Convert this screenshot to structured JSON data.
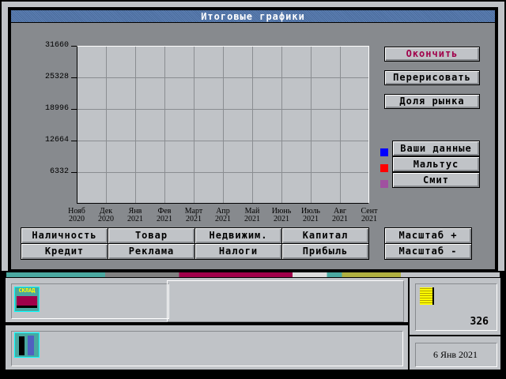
{
  "window": {
    "title": "Итоговые графики"
  },
  "chart_data": {
    "type": "line",
    "title": "Итоговые графики",
    "x": [
      "Нояб 2020",
      "Дек 2020",
      "Янв 2021",
      "Фев 2021",
      "Март 2021",
      "Апр 2021",
      "Май 2021",
      "Июнь 2021",
      "Июль 2021",
      "Авг 2021",
      "Сент 2021"
    ],
    "x_top": [
      "Нояб",
      "Дек",
      "Янв",
      "Фев",
      "Март",
      "Апр",
      "Май",
      "Июнь",
      "Июль",
      "Авг",
      "Сент"
    ],
    "x_bottom": [
      "2020",
      "2020",
      "2021",
      "2021",
      "2021",
      "2021",
      "2021",
      "2021",
      "2021",
      "2021",
      "2021"
    ],
    "yticks": [
      "31660",
      "25328",
      "18996",
      "12664",
      "6332"
    ],
    "ylim": [
      0,
      31660
    ],
    "grid": true,
    "series": [
      {
        "name": "Ваши данные",
        "color": "#0000ff",
        "values": []
      },
      {
        "name": "Мальтус",
        "color": "#ff0000",
        "values": []
      },
      {
        "name": "Смит",
        "color": "#a050a0",
        "values": []
      }
    ]
  },
  "side_buttons": {
    "finish": "Окончить",
    "redraw": "Перерисовать",
    "market_share": "Доля рынка"
  },
  "legend": [
    "Ваши данные",
    "Мальтус",
    "Смит"
  ],
  "category_buttons": [
    [
      "Наличность",
      "Товар",
      "Недвижим.",
      "Капитал"
    ],
    [
      "Кредит",
      "Реклама",
      "Налоги",
      "Прибыль"
    ]
  ],
  "scale": {
    "plus": "Масштаб +",
    "minus": "Масштаб -"
  },
  "status": {
    "warehouse_icon_text": "СКЛАД",
    "money": "326",
    "date": "6 Янв 2021"
  },
  "colors": {
    "finish_text": "#a0004a"
  }
}
